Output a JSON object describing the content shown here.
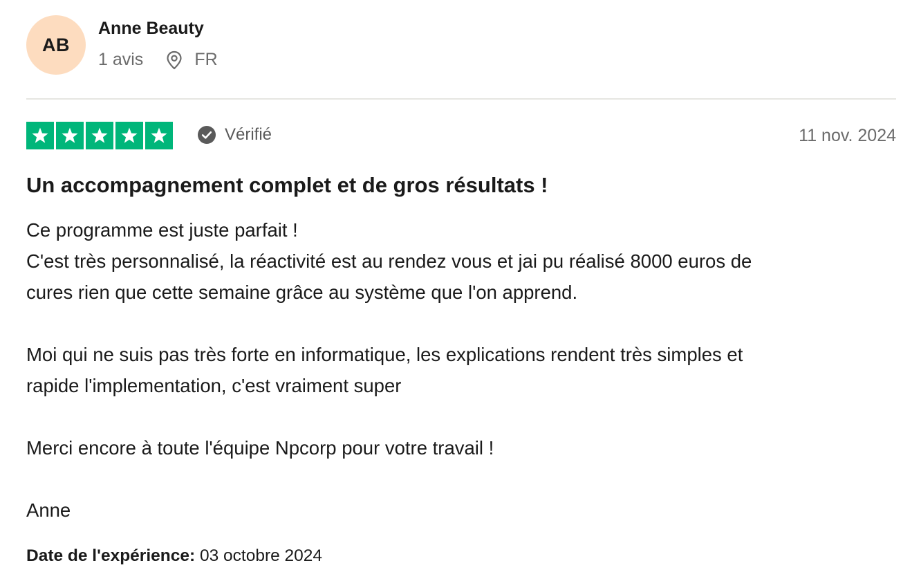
{
  "consumer": {
    "initials": "AB",
    "name": "Anne Beauty",
    "review_count": "1 avis",
    "country": "FR",
    "avatar_color": "#fddcbf"
  },
  "rating": {
    "stars": 5,
    "max_stars": 5,
    "star_color": "#00b67a",
    "verified_label": "Vérifié",
    "date": "11 nov. 2024"
  },
  "review": {
    "title": "Un accompagnement complet et de gros résultats !",
    "lines": [
      "Ce programme est juste parfait !",
      "C'est très personnalisé, la réactivité est au rendez vous et jai pu réalisé 8000 euros de",
      "cures rien que cette semaine grâce au système que l'on apprend.",
      "",
      "Moi qui ne suis pas très forte en informatique, les explications rendent très simples et",
      "rapide l'implementation, c'est vraiment super",
      "",
      "Merci encore à toute l'équipe Npcorp pour votre travail !",
      "",
      "Anne"
    ]
  },
  "experience": {
    "label": "Date de l'expérience:",
    "value": "03 octobre 2024"
  },
  "icons": {
    "location": "location-pin-icon",
    "verified": "check-circle-icon",
    "star": "star-icon"
  }
}
